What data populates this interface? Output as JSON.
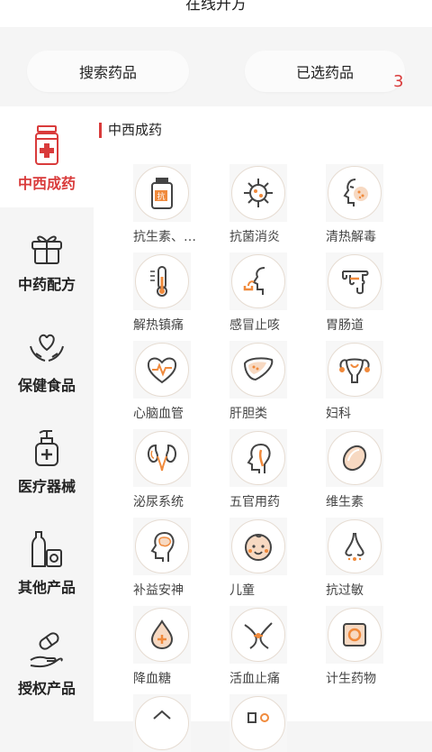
{
  "header": {
    "title": "在线开方"
  },
  "topbar": {
    "search_label": "搜索药品",
    "selected_label": "已选药品",
    "selected_count": "3"
  },
  "sidebar": {
    "items": [
      {
        "label": "中西成药",
        "icon": "medicine-bottle-icon",
        "active": true
      },
      {
        "label": "中药配方",
        "icon": "gift-box-icon",
        "active": false
      },
      {
        "label": "保健食品",
        "icon": "heart-hands-icon",
        "active": false
      },
      {
        "label": "医疗器械",
        "icon": "sanitizer-bottle-icon",
        "active": false
      },
      {
        "label": "其他产品",
        "icon": "products-icon",
        "active": false
      },
      {
        "label": "授权产品",
        "icon": "pill-hand-icon",
        "active": false
      }
    ]
  },
  "section": {
    "title": "中西成药"
  },
  "categories": [
    {
      "label": "抗生素、…",
      "icon": "antibiotic-bottle-icon"
    },
    {
      "label": "抗菌消炎",
      "icon": "virus-icon"
    },
    {
      "label": "清热解毒",
      "icon": "face-fever-icon"
    },
    {
      "label": "解热镇痛",
      "icon": "thermometer-icon"
    },
    {
      "label": "感冒止咳",
      "icon": "cough-icon"
    },
    {
      "label": "胃肠道",
      "icon": "intestine-icon"
    },
    {
      "label": "心脑血管",
      "icon": "heart-pulse-icon"
    },
    {
      "label": "肝胆类",
      "icon": "liver-icon"
    },
    {
      "label": "妇科",
      "icon": "uterus-icon"
    },
    {
      "label": "泌尿系统",
      "icon": "kidney-icon"
    },
    {
      "label": "五官用药",
      "icon": "head-profile-icon"
    },
    {
      "label": "维生素",
      "icon": "capsule-icon"
    },
    {
      "label": "补益安神",
      "icon": "brain-icon"
    },
    {
      "label": "儿童",
      "icon": "baby-face-icon"
    },
    {
      "label": "抗过敏",
      "icon": "nose-icon"
    },
    {
      "label": "降血糖",
      "icon": "blood-drop-icon"
    },
    {
      "label": "活血止痛",
      "icon": "joint-pain-icon"
    },
    {
      "label": "计生药物",
      "icon": "contraceptive-icon"
    },
    {
      "label": "",
      "icon": "partial-icon-a"
    },
    {
      "label": "",
      "icon": "partial-icon-b"
    }
  ],
  "colors": {
    "accent": "#d93b3b",
    "icon_orange": "#f08a3c",
    "icon_stroke": "#444444"
  }
}
